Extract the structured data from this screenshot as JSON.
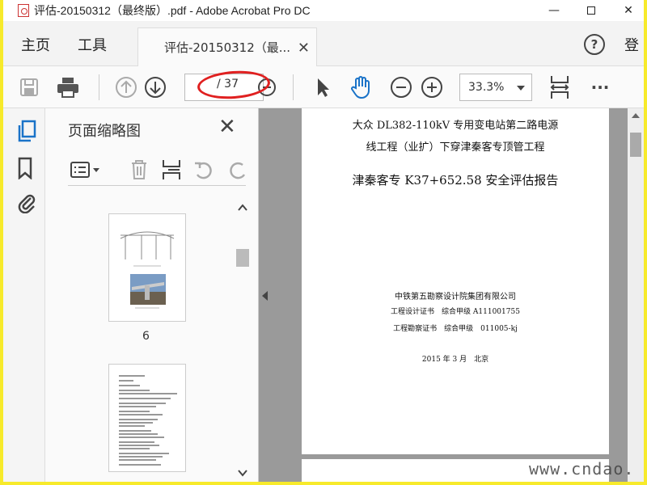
{
  "window": {
    "title": "评估-20150312（最终版）.pdf - Adobe Acrobat Pro DC",
    "minimize": "—",
    "close": "✕"
  },
  "tabs": {
    "home": "主页",
    "tools": "工具",
    "document": "评估-20150312（最...",
    "document_close": "✕",
    "help": "?",
    "login": "登"
  },
  "toolbar": {
    "page_total": "/ 37",
    "zoom": "33.3%",
    "more": "···"
  },
  "thumbnail_panel": {
    "title": "页面缩略图",
    "close": "✕",
    "thumbnails": [
      {
        "page": "6"
      },
      {
        "page": ""
      }
    ]
  },
  "document": {
    "line1": "大众 DL382-110kV 专用变电站第二路电源",
    "line2": "线工程（业扩）下穿津秦客专顶管工程",
    "line3": "津秦客专 K37+652.58 安全评估报告",
    "line4": "中铁第五勘察设计院集团有限公司",
    "line5": "工程设计证书　综合甲级  A111001755",
    "line6": "工程勘察证书　综合甲级　011005-kj",
    "line7": "2015 年 3 月　北京"
  },
  "watermark": "www.cndao.",
  "colors": {
    "frame": "#f7ea2b",
    "accent_blue": "#1a73c8",
    "annotation_red": "#e02020"
  },
  "icons": [
    "acrobat-icon",
    "save-icon",
    "print-icon",
    "prev-page-icon",
    "next-page-icon",
    "zoom-out-small-icon",
    "select-arrow-icon",
    "hand-icon",
    "zoom-out-icon",
    "zoom-in-icon",
    "fit-page-icon",
    "more-icon",
    "thumbnails-icon",
    "bookmark-icon",
    "attachment-icon",
    "options-icon",
    "delete-icon",
    "insert-icon",
    "rotate-left-icon",
    "rotate-right-icon"
  ]
}
